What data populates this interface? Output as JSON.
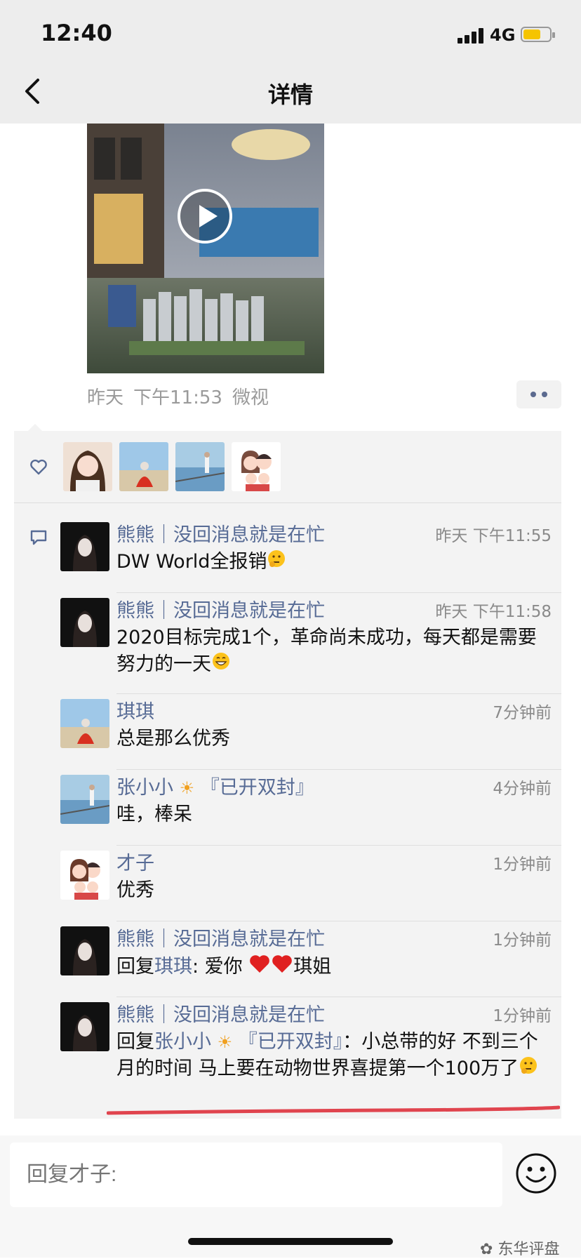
{
  "status_bar": {
    "time": "12:40",
    "network": "4G"
  },
  "nav": {
    "title": "详情"
  },
  "post": {
    "meta": [
      "昨天",
      "下午11:53",
      "微视"
    ]
  },
  "likes": {
    "avatars": [
      "avatar-1",
      "avatar-2",
      "avatar-3",
      "avatar-4"
    ]
  },
  "comments": [
    {
      "name": "熊熊｜没回消息就是在忙",
      "time": "昨天 下午11:55",
      "text": "DW World全报销"
    },
    {
      "name": "熊熊｜没回消息就是在忙",
      "time": "昨天 下午11:58",
      "text": "2020目标完成1个，革命尚未成功，每天都是需要努力的一天"
    },
    {
      "name": "琪琪",
      "time": "7分钟前",
      "text": "总是那么优秀"
    },
    {
      "name_prefix": "张小小",
      "name_suffix": "『已开双封』",
      "time": "4分钟前",
      "text": "哇，棒呆"
    },
    {
      "name": "才子",
      "time": "1分钟前",
      "text": "优秀"
    },
    {
      "name": "熊熊｜没回消息就是在忙",
      "time": "1分钟前",
      "reply_prefix": "回复",
      "reply_to": "琪琪",
      "text_before": ": 爱你",
      "text_after": "琪姐"
    },
    {
      "name": "熊熊｜没回消息就是在忙",
      "time": "1分钟前",
      "reply_prefix": "回复",
      "reply_to_prefix": "张小小",
      "reply_to_suffix": "『已开双封』",
      "text": "：小总带的好 不到三个月的时间 马上要在动物世界喜提第一个100万了"
    }
  ],
  "input": {
    "placeholder": "回复才子:"
  },
  "watermark": "东华评盘",
  "colors": {
    "link": "#576b95",
    "panel": "#f3f3f3",
    "battery": "#f5c400",
    "highlight": "#e0444e"
  }
}
